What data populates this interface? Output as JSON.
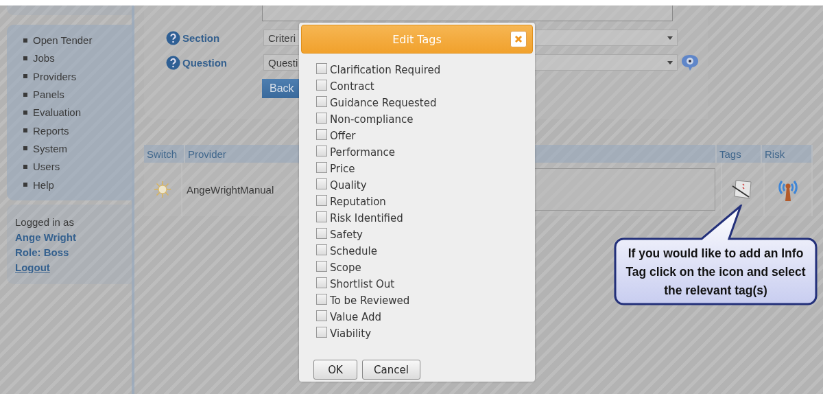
{
  "sidebar": {
    "menu": [
      {
        "label": "Open Tender"
      },
      {
        "label": "Jobs"
      },
      {
        "label": "Providers"
      },
      {
        "label": "Panels"
      },
      {
        "label": "Evaluation"
      },
      {
        "label": "Reports"
      },
      {
        "label": "System"
      },
      {
        "label": "Users"
      },
      {
        "label": "Help"
      }
    ],
    "login": {
      "caption": "Logged in as",
      "user": "Ange Wright",
      "role": "Role: Boss",
      "logout": "Logout"
    }
  },
  "form": {
    "fields": [
      {
        "label": "Section",
        "value": "Criteri"
      },
      {
        "label": "Question",
        "value": "Questi"
      }
    ],
    "back_button": "Back"
  },
  "table": {
    "columns": [
      "Switch",
      "Provider",
      "Tags",
      "Risk"
    ],
    "rows": [
      {
        "provider": "AngeWrightManual"
      }
    ]
  },
  "dialog": {
    "title": "Edit Tags",
    "tags": [
      {
        "label": "Clarification Required",
        "checked": false
      },
      {
        "label": "Contract",
        "checked": false
      },
      {
        "label": "Guidance Requested",
        "checked": false
      },
      {
        "label": "Non-compliance",
        "checked": false
      },
      {
        "label": "Offer",
        "checked": false
      },
      {
        "label": "Performance",
        "checked": false
      },
      {
        "label": "Price",
        "checked": false
      },
      {
        "label": "Quality",
        "checked": false
      },
      {
        "label": "Reputation",
        "checked": false
      },
      {
        "label": "Risk Identified",
        "checked": false
      },
      {
        "label": "Safety",
        "checked": false
      },
      {
        "label": "Schedule",
        "checked": false
      },
      {
        "label": "Scope",
        "checked": false
      },
      {
        "label": "Shortlist Out",
        "checked": false
      },
      {
        "label": "To be Reviewed",
        "checked": false
      },
      {
        "label": "Value Add",
        "checked": false
      },
      {
        "label": "Viability",
        "checked": false
      }
    ],
    "buttons": [
      "OK",
      "Cancel"
    ]
  },
  "callout": {
    "text": "If you would like to add an Info Tag click on the icon and select the relevant tag(s)"
  }
}
